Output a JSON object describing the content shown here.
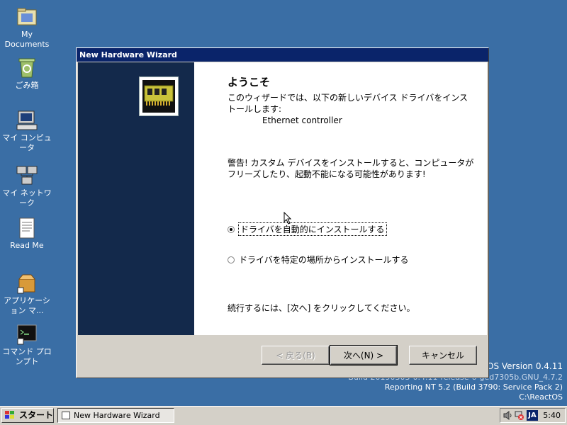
{
  "desktop": {
    "icons": [
      {
        "label": "My Documents"
      },
      {
        "label": "ごみ箱"
      },
      {
        "label": "マイ コンピュータ"
      },
      {
        "label": "マイ ネットワーク"
      },
      {
        "label": "Read Me"
      },
      {
        "label": "アプリケーション マ..."
      },
      {
        "label": "コマンド プロンプト"
      }
    ],
    "version": {
      "line1": "ReactOS Version 0.4.11",
      "line2": "Build 20190303-0.4.11-release-6-ged7305b.GNU_4.7.2",
      "line3": "Reporting NT 5.2 (Build 3790: Service Pack 2)",
      "line4": "C:\\ReactOS"
    }
  },
  "dialog": {
    "title": "New Hardware Wizard",
    "heading": "ようこそ",
    "intro": "このウィザードでは、以下の新しいデバイス ドライバをインストールします:",
    "device_name": "Ethernet controller",
    "warning": "警告! カスタム デバイスをインストールすると、コンピュータがフリーズしたり、起動不能になる可能性があります!",
    "options": [
      {
        "label": "ドライバを自動的にインストールする",
        "checked": true
      },
      {
        "label": "ドライバを特定の場所からインストールする",
        "checked": false
      }
    ],
    "continue_text": "続行するには、[次へ] をクリックしてください。",
    "buttons": {
      "back": "< 戻る(B)",
      "next": "次へ(N) >",
      "cancel": "キャンセル"
    }
  },
  "taskbar": {
    "start_label": "スタート",
    "task_title": "New Hardware Wizard",
    "lang": "JA",
    "clock": "5:40"
  }
}
